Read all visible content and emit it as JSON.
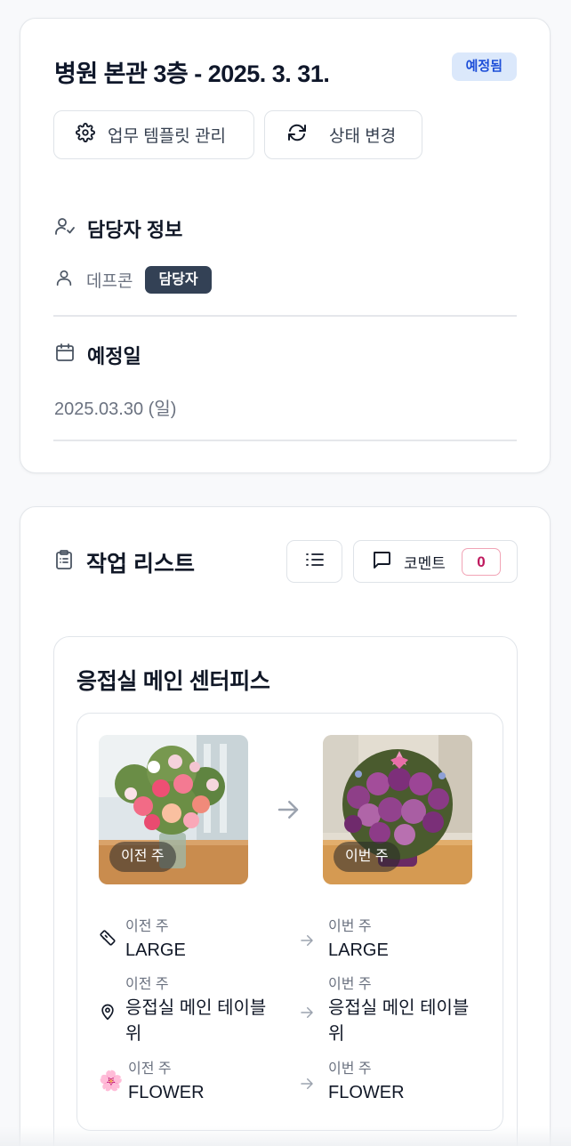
{
  "schedule": {
    "title": "병원 본관 3층 - 2025. 3. 31.",
    "status_badge": "예정됨",
    "template_button": "업무 템플릿 관리",
    "status_button": "상태 변경",
    "assignee_section": {
      "heading": "담당자 정보",
      "name": "데프콘",
      "role": "담당자"
    },
    "date_section": {
      "heading": "예정일",
      "value": "2025.03.30 (일)"
    }
  },
  "task_list": {
    "heading": "작업 리스트",
    "comment_label": "코멘트",
    "comment_count": "0",
    "task": {
      "name": "응접실 메인 센터피스",
      "photo_prev_tag": "이전 주",
      "photo_curr_tag": "이번 주",
      "rows": [
        {
          "icon": "ruler-icon",
          "prev_caption": "이전 주",
          "prev_value": "LARGE",
          "curr_caption": "이번 주",
          "curr_value": "LARGE"
        },
        {
          "icon": "location-pin-icon",
          "prev_caption": "이전 주",
          "prev_value": "응접실 메인 테이블 위",
          "curr_caption": "이번 주",
          "curr_value": "응접실 메인 테이블 위"
        },
        {
          "icon": "flower-icon",
          "prev_caption": "이전 주",
          "prev_value": "FLOWER",
          "curr_caption": "이번 주",
          "curr_value": "FLOWER"
        }
      ]
    }
  },
  "colors": {
    "badge_bg": "#dbe8fb",
    "badge_text": "#1d4ed8",
    "role_chip_bg": "#334155",
    "comment_count_border": "#f1a4b6",
    "comment_count_text": "#be185d"
  }
}
